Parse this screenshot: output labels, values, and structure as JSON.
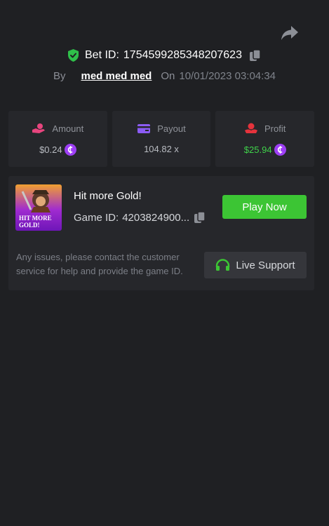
{
  "header": {
    "bet_label": "Bet ID:",
    "bet_id": "1754599285348207623",
    "by_label": "By",
    "username": "med med med",
    "on_label": "On",
    "datetime": "10/01/2023 03:04:34"
  },
  "stats": {
    "amount": {
      "label": "Amount",
      "value": "$0.24"
    },
    "payout": {
      "label": "Payout",
      "value": "104.82 x"
    },
    "profit": {
      "label": "Profit",
      "value": "$25.94"
    }
  },
  "game": {
    "title": "Hit more Gold!",
    "id_label": "Game ID:",
    "id_value": "4203824900...",
    "thumb_line1": "HIT MORE",
    "thumb_line2": "GOLD!",
    "play_label": "Play Now"
  },
  "support": {
    "text": "Any issues, please contact the customer service for help and provide the game ID.",
    "button_label": "Live Support"
  },
  "icons": {
    "share": "share-arrow-icon",
    "shield": "shield-check-icon",
    "copy": "copy-icon",
    "amount": "coin-hand-icon",
    "payout": "card-icon",
    "profit": "profit-hand-icon",
    "coin": "currency-coin-icon",
    "headset": "headset-icon"
  },
  "colors": {
    "background": "#1f2023",
    "card": "#26272b",
    "accent_green": "#3cc534",
    "profit_green": "#3fd24a",
    "coin_purple": "#9e3ff5",
    "amount_pink": "#e8457e",
    "payout_purple": "#8c5cf5",
    "profit_red": "#e5333c"
  }
}
